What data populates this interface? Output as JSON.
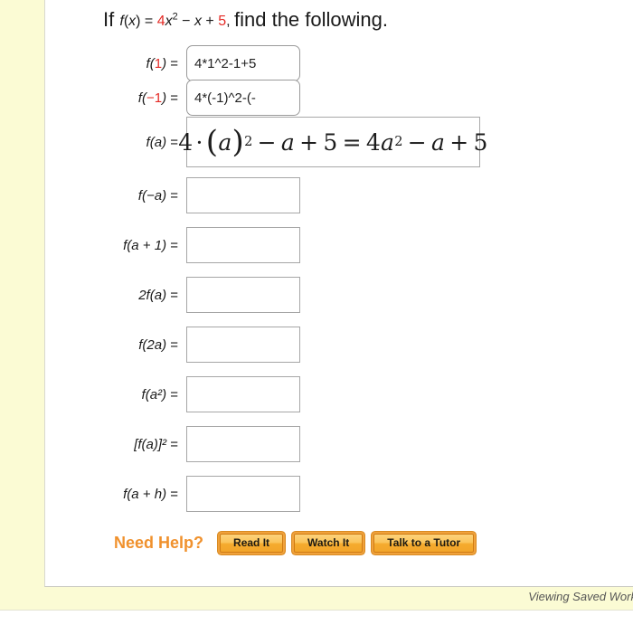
{
  "colors": {
    "cream_background": "#fbfbd4",
    "panel_background": "#ffffff",
    "accent_red": "#e42b26",
    "need_help_orange": "#f0912d",
    "button_orange": "#f5ab2e"
  },
  "question": {
    "lead_word": "If",
    "function_name": "f",
    "function_arg": "x",
    "equals": "=",
    "coefficient": "4",
    "term_variable": "x",
    "exponent": "2",
    "minus": "−",
    "linear_term": "x",
    "plus": "+",
    "constant": "5",
    "comma": ",",
    "instruction": "find the following."
  },
  "rows": [
    {
      "label_prefix": "f(",
      "label_arg": "1",
      "label_arg_red": true,
      "label_suffix": ")",
      "equals": "=",
      "value": "4*1^2-1+5",
      "filled": true,
      "kind": "text-input"
    },
    {
      "label_prefix": "f(",
      "label_arg": "−1",
      "label_arg_red": true,
      "label_suffix": ")",
      "equals": "=",
      "value": "4*(-1)^2-(-",
      "filled": true,
      "kind": "text-input"
    },
    {
      "label_prefix": "f(",
      "label_arg": "a",
      "label_arg_red": false,
      "label_suffix": ")",
      "equals": "=",
      "value": "",
      "filled": false,
      "kind": "math-display"
    },
    {
      "label_prefix": "f(",
      "label_arg": "−a",
      "label_arg_red": false,
      "label_suffix": ")",
      "equals": "=",
      "value": "",
      "filled": false,
      "kind": "text-input"
    },
    {
      "label_prefix": "f(",
      "label_arg": "a + 1",
      "label_arg_red": false,
      "label_suffix": ")",
      "equals": "=",
      "value": "",
      "filled": false,
      "kind": "text-input"
    },
    {
      "label_prefix": "2f(",
      "label_arg": "a",
      "label_arg_red": false,
      "label_suffix": ")",
      "equals": "=",
      "value": "",
      "filled": false,
      "kind": "text-input"
    },
    {
      "label_prefix": "f(",
      "label_arg": "2a",
      "label_arg_red": false,
      "label_suffix": ")",
      "equals": "=",
      "value": "",
      "filled": false,
      "kind": "text-input"
    },
    {
      "label_prefix": "f(",
      "label_arg": "a²",
      "label_arg_red": false,
      "label_suffix": ")",
      "equals": "=",
      "value": "",
      "filled": false,
      "kind": "text-input"
    },
    {
      "label_prefix": "[f(",
      "label_arg": "a",
      "label_arg_red": false,
      "label_suffix": ")]²",
      "equals": "=",
      "value": "",
      "filled": false,
      "kind": "text-input"
    },
    {
      "label_prefix": "f(",
      "label_arg": "a + h",
      "label_arg_red": false,
      "label_suffix": ")",
      "equals": "=",
      "value": "",
      "filled": false,
      "kind": "text-input"
    }
  ],
  "labels": {
    "row1": "f(1)  =",
    "row2": "f(−1)  =",
    "row3": "f(a)  =",
    "row4": "f(−a)  =",
    "row5": "f(a + 1)  =",
    "row6": "2f(a)  =",
    "row7": "f(2a)  =",
    "row8": "f(a²)  =",
    "row9": "[f(a)]²  =",
    "row10": "f(a + h)  ="
  },
  "math_answer": {
    "coefficient": "4",
    "dot": "·",
    "open_paren": "(",
    "variable": "a",
    "close_paren": ")",
    "exponent": "2",
    "minus": "−",
    "linear": "a",
    "plus": "+",
    "constant": "5",
    "equals": "=",
    "rhs_coefficient": "4",
    "rhs_variable": "a",
    "rhs_exponent": "2",
    "rhs_linear": "a",
    "rhs_constant": "5",
    "plain": "4·(a)² − a + 5 = 4a² − a + 5"
  },
  "help": {
    "label": "Need Help?",
    "buttons": [
      {
        "label": "Read It"
      },
      {
        "label": "Watch It"
      },
      {
        "label": "Talk to a Tutor"
      }
    ]
  },
  "footer": {
    "status": "Viewing Saved Work"
  }
}
